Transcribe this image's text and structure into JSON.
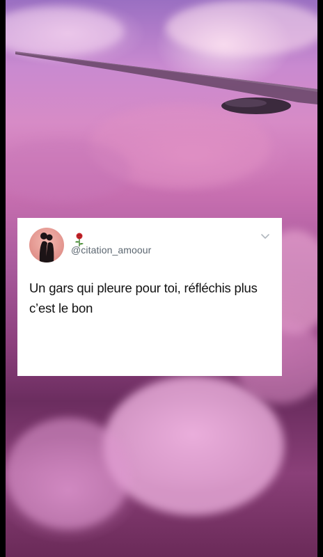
{
  "tweet": {
    "handle": "@citation_amoour",
    "text": "Un gars qui pleure pour toi, réfléchis plus c’est le bon"
  },
  "icons": {
    "avatar": "couple-silhouette-avatar",
    "decoration": "rose-icon",
    "menu": "chevron-down-icon"
  },
  "colors": {
    "card_background": "#ffffff",
    "handle_text": "#5b6670",
    "body_text": "#111111"
  }
}
